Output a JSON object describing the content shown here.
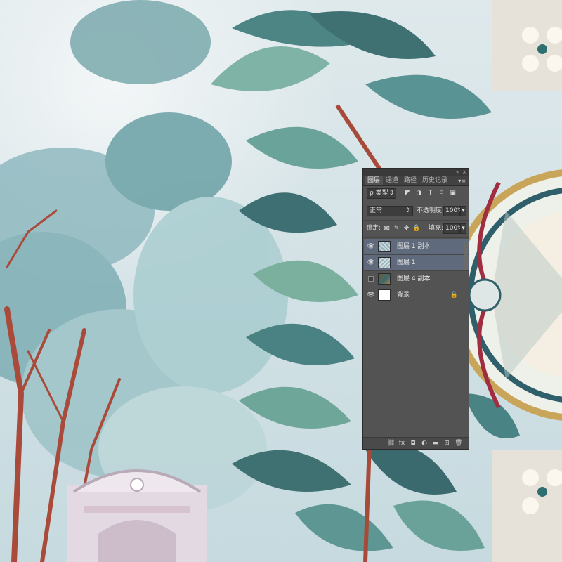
{
  "panel": {
    "collapse_glyph": "«",
    "close_glyph": "×",
    "tabs": [
      {
        "label": "图层",
        "active": true
      },
      {
        "label": "通道",
        "active": false
      },
      {
        "label": "路径",
        "active": false
      },
      {
        "label": "历史记录",
        "active": false
      }
    ],
    "tab_menu_glyph": "▾≡",
    "filter": {
      "label": "ρ 类型",
      "arrow": "⇕",
      "icons": [
        "◩",
        "◑",
        "T",
        "⌑",
        "▣"
      ]
    },
    "blend_mode": {
      "value": "正常",
      "arrow": "⇕"
    },
    "opacity": {
      "label": "不透明度:",
      "value": "100%",
      "arrow": "▾"
    },
    "lock": {
      "label": "锁定:",
      "icons": [
        "▩",
        "✎",
        "✥",
        "🔒"
      ]
    },
    "fill": {
      "label": "填充:",
      "value": "100%",
      "arrow": "▾"
    },
    "layers": [
      {
        "name": "图层 1 副本",
        "visible": true,
        "selected": true,
        "thumb": "pattern"
      },
      {
        "name": "图层 1",
        "visible": true,
        "selected": true,
        "thumb": "pattern"
      },
      {
        "name": "图层 4 副本",
        "visible": false,
        "selected": false,
        "thumb": "painting"
      },
      {
        "name": "背景",
        "visible": true,
        "selected": false,
        "thumb": "white",
        "locked": true
      }
    ],
    "eye_glyph": "👁",
    "lock_glyph": "🔒",
    "footer_icons": [
      "⛓",
      "fx",
      "◘",
      "◐",
      "▬",
      "⊞",
      "🗑"
    ]
  },
  "colors": {
    "panel_bg": "#535353",
    "selected_row": "#5f6b7c",
    "sky": "#e8eef0",
    "foliage": "#4f8b8f",
    "trunk": "#a64a3a",
    "gold": "#c9a55a"
  }
}
